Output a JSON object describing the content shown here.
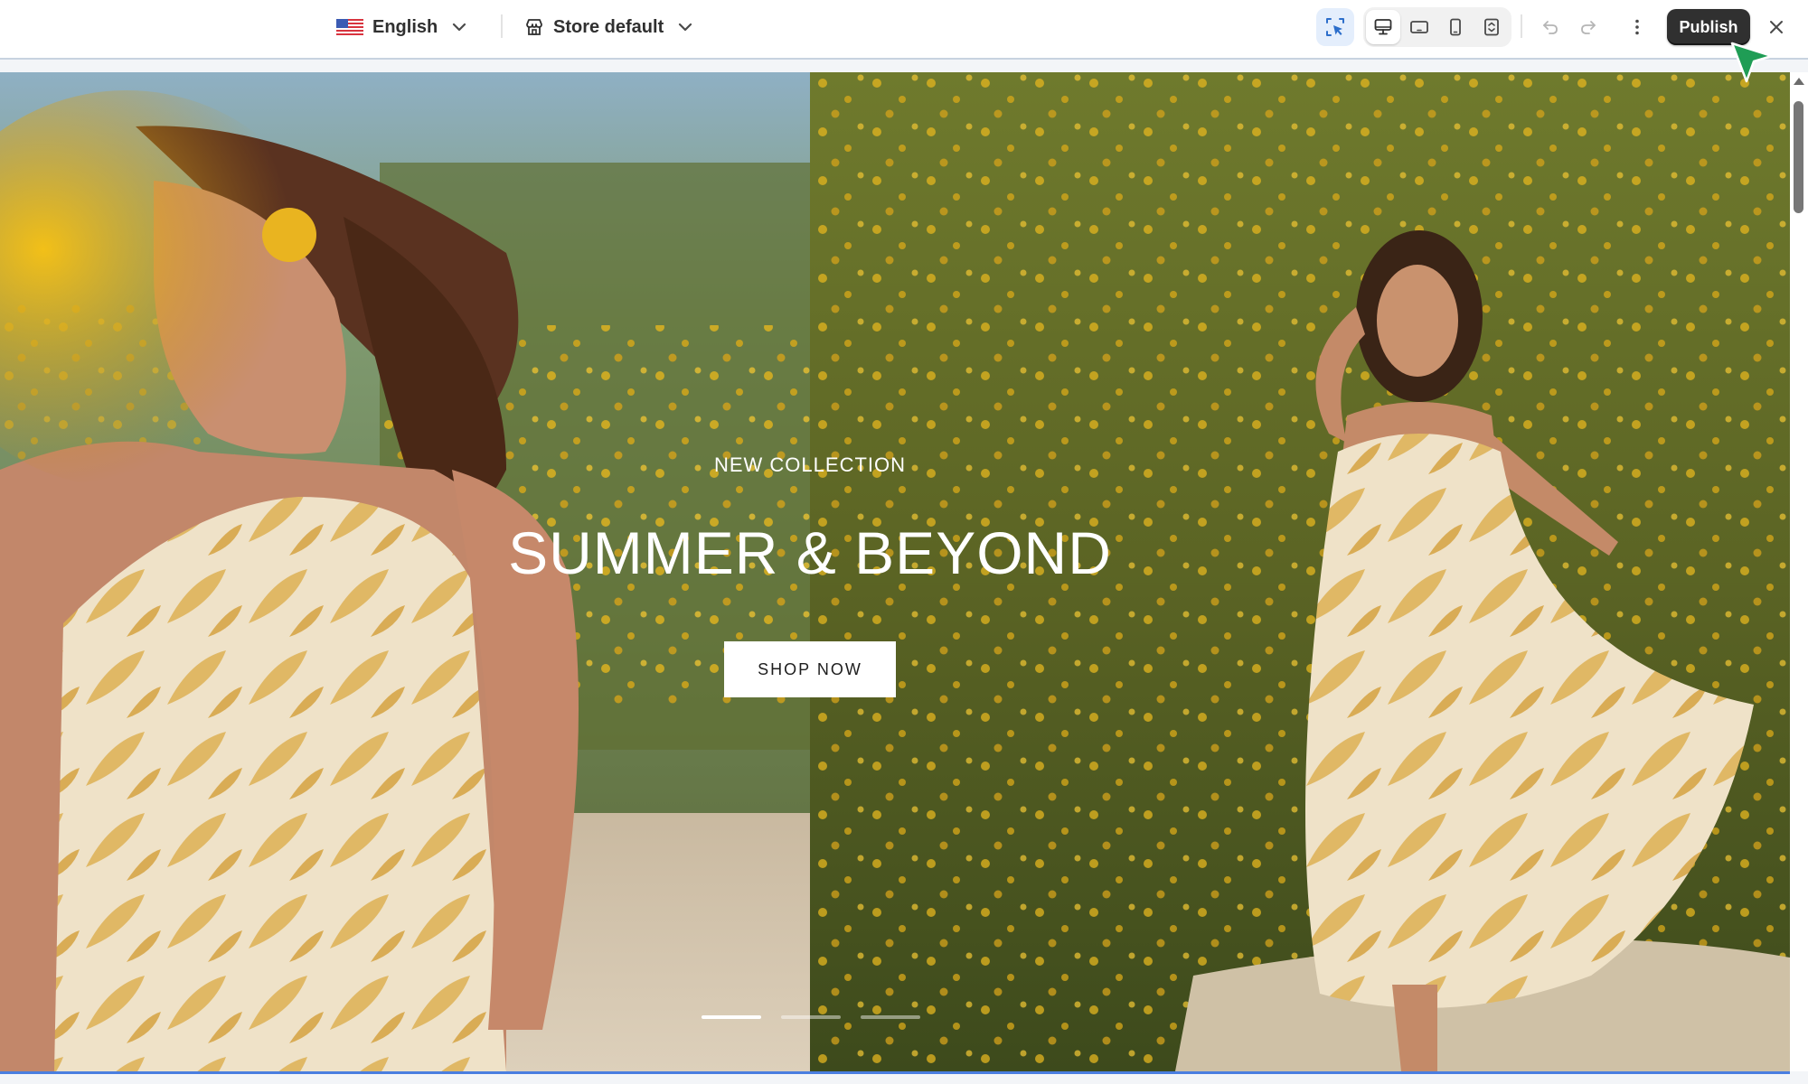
{
  "toolbar": {
    "language": {
      "label": "English",
      "flag": "us-flag-icon"
    },
    "store": {
      "label": "Store default",
      "icon": "store-icon"
    },
    "inspector_icon": "select-cursor-icon",
    "devices": [
      "desktop-icon",
      "tablet-landscape-icon",
      "mobile-icon",
      "fullscreen-icon"
    ],
    "undo_icon": "undo-icon",
    "redo_icon": "redo-icon",
    "more_icon": "more-vertical-icon",
    "publish_label": "Publish",
    "close_icon": "close-icon"
  },
  "hero": {
    "eyebrow": "NEW COLLECTION",
    "headline": "SUMMER & BEYOND",
    "cta_label": "SHOP NOW",
    "slides": {
      "count": 3,
      "active": 0
    }
  },
  "colors": {
    "accent": "#4a7ee0",
    "publish": "#303030",
    "cursor": "#1f9d55"
  }
}
